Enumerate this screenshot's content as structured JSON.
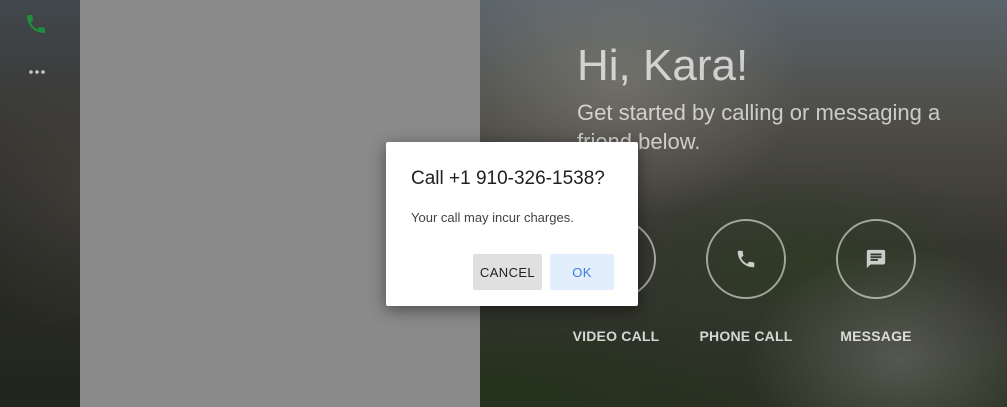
{
  "greeting": {
    "title": "Hi, Kara!",
    "subtitle": "Get started by calling or messaging a friend below."
  },
  "sidebar": {
    "icons": [
      "phone-icon",
      "more-icon"
    ],
    "accent": "#1e8e3e"
  },
  "actions": [
    {
      "label": "VIDEO CALL",
      "icon": "video-icon"
    },
    {
      "label": "PHONE CALL",
      "icon": "phone-icon"
    },
    {
      "label": "MESSAGE",
      "icon": "message-icon"
    }
  ],
  "dialog": {
    "title": "Call +1 910-326-1538?",
    "body": "Your call may incur charges.",
    "cancel_label": "CANCEL",
    "ok_label": "OK"
  },
  "colors": {
    "ok_text": "#3f7fe0",
    "ok_bg": "#e3eefc",
    "cancel_bg": "#e0e0e0"
  }
}
